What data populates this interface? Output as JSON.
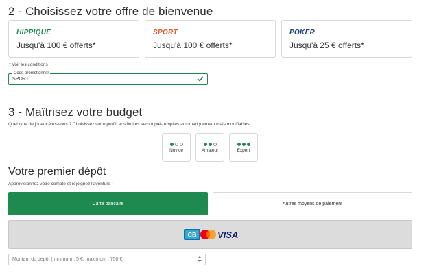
{
  "section2": {
    "title": "2 - Choisissez votre offre de bienvenue",
    "offers": [
      {
        "brand": "HIPPIQUE",
        "amount": "Jusqu'à 100 € offerts*",
        "color": "#1e8a4f"
      },
      {
        "brand": "SPORT",
        "amount": "Jusqu'à 100 € offerts*",
        "color": "#e0582a"
      },
      {
        "brand": "POKER",
        "amount": "Jusqu'à 25 € offerts*",
        "color": "#1f3f7a"
      }
    ],
    "conditions_prefix": "* ",
    "conditions_link": "Voir les conditions",
    "promo": {
      "label": "Code promotionnel",
      "value": "SPORT"
    }
  },
  "section3": {
    "title": "3 - Maîtrisez votre budget",
    "description": "Quel type de joueur êtes-vous ? Choisissez votre profil, vos limites seront pré-remplies automatiquement mais modifiables.",
    "player_types": [
      {
        "label": "Novice",
        "level": 1
      },
      {
        "label": "Amateur",
        "level": 2
      },
      {
        "label": "Expert",
        "level": 3
      }
    ]
  },
  "deposit": {
    "title": "Votre premier dépôt",
    "description": "Approvisionnez votre compte et rejoignez l'aventure !",
    "card_button": "Carte bancaire",
    "other_button": "Autres moyens de paiement",
    "card_logos": [
      "CB",
      "mastercard-icon",
      "VISA"
    ],
    "amount_placeholder": "Montant du dépôt (minimum : 5 €, maximum : 750 €)"
  },
  "colors": {
    "accent": "#1e8a4f",
    "sport": "#e0582a",
    "poker": "#1f3f7a",
    "visa": "#1a1f71"
  }
}
